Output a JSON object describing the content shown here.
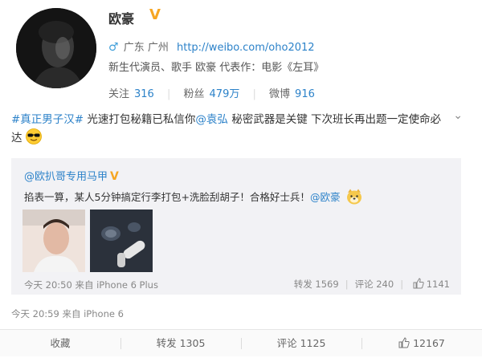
{
  "profile": {
    "name": "欧豪",
    "verified_mark": "V",
    "gender_symbol": "♂",
    "location": "广东 广州",
    "url": "http://weibo.com/oho2012",
    "bio": "新生代演员、歌手 欧豪 代表作：电影《左耳》",
    "stats": [
      {
        "label": "关注",
        "value": "316"
      },
      {
        "label": "粉丝",
        "value": "479万"
      },
      {
        "label": "微博",
        "value": "916"
      }
    ]
  },
  "post": {
    "hashtag": "#真正男子汉#",
    "text1": " 光速打包秘籍已私信你",
    "mention": "@袁弘",
    "text2": " 秘密武器是关键 下次班长再出题一定使命必达",
    "emoji": "cool-sunglasses-emoji",
    "time": "今天 20:59",
    "source": "来自 iPhone 6"
  },
  "quote": {
    "author": "@欧扒哥专用马甲",
    "verified_mark": "V",
    "text": "掐表一算，某人5分钟搞定行李打包+洗脸刮胡子！合格好士兵！",
    "mention": "@欧豪",
    "emoji": "dog-emoji",
    "time": "今天 20:50",
    "source": "来自 iPhone 6 Plus",
    "repost_label": "转发",
    "repost_count": "1569",
    "comment_label": "评论",
    "comment_count": "240",
    "like_count": "1141"
  },
  "actions": {
    "favorite_label": "收藏",
    "repost_label": "转发",
    "repost_count": "1305",
    "comment_label": "评论",
    "comment_count": "1125",
    "like_count": "12167"
  },
  "colors": {
    "link": "#2c82c9",
    "verified": "#f6a623",
    "quote_bg": "#f2f2f5"
  }
}
